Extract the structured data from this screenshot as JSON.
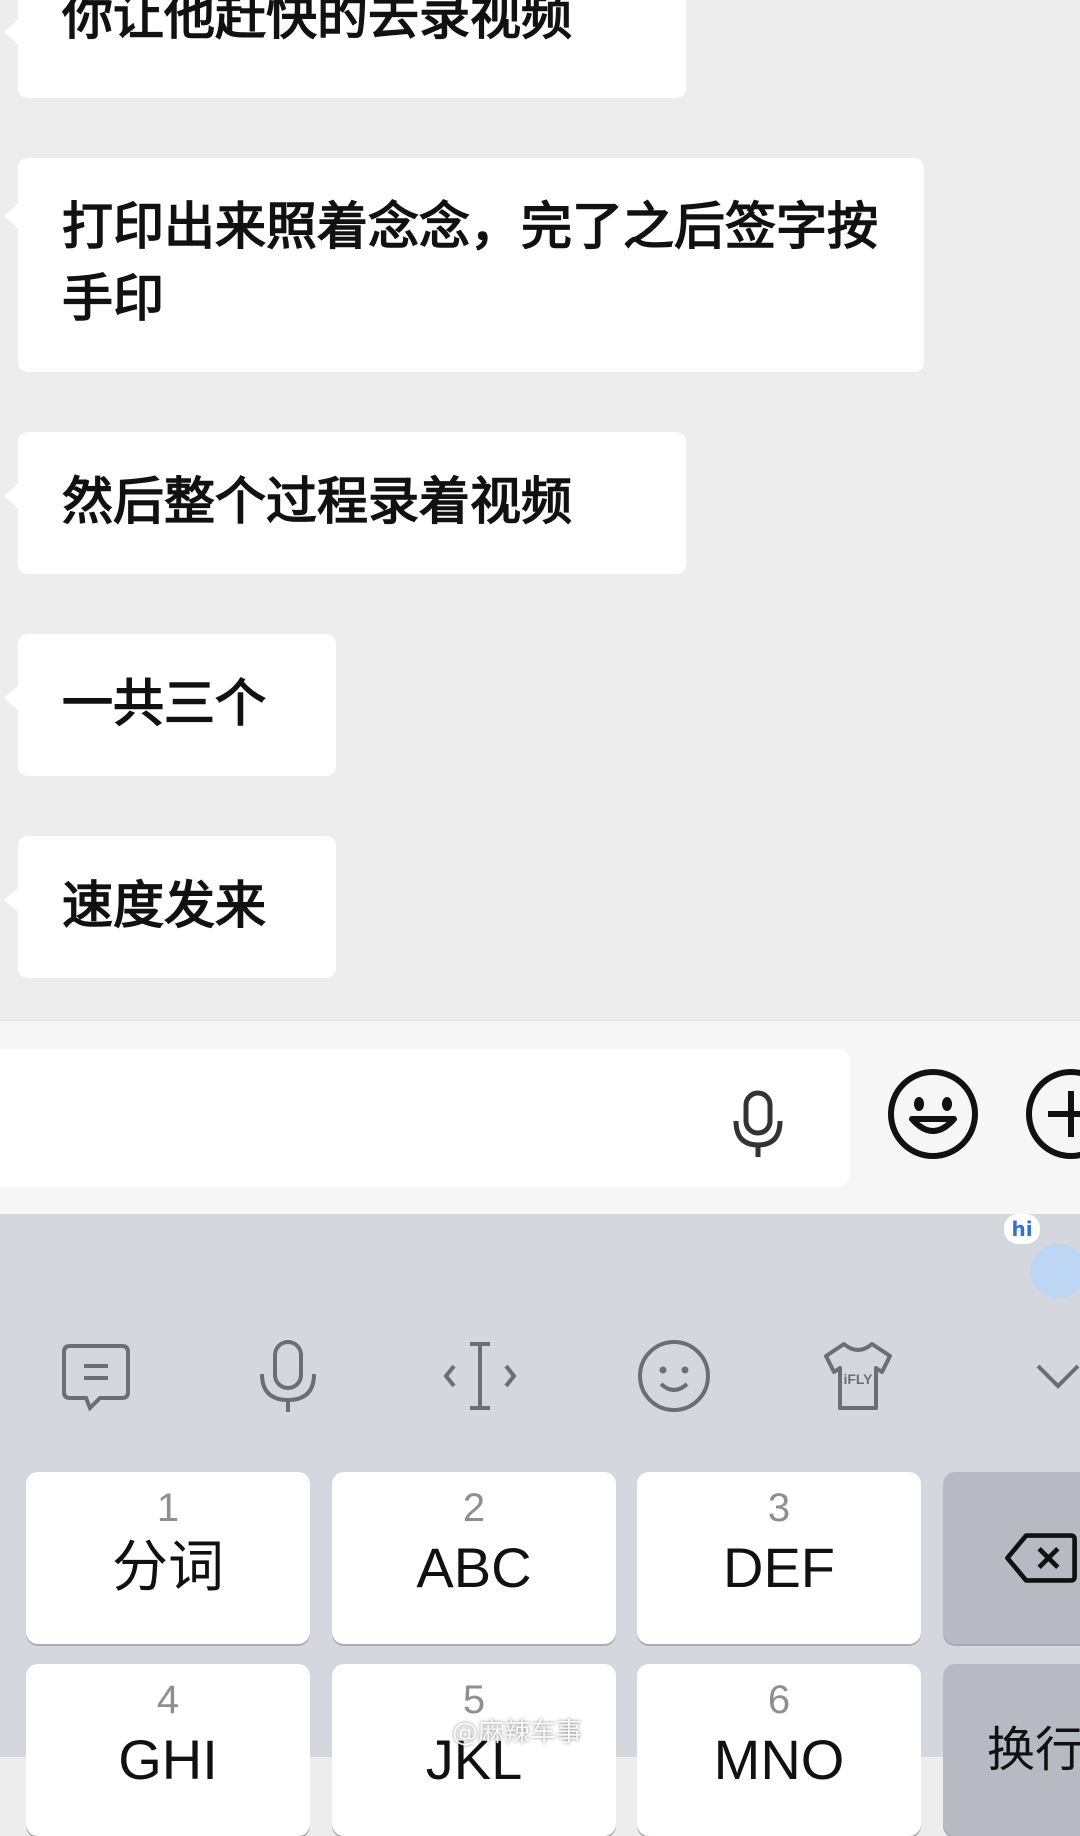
{
  "messages": [
    {
      "text": "你让他赶快的去录视频"
    },
    {
      "text": "打印出来照着念念，完了之后签字按手印"
    },
    {
      "text": "然后整个过程录着视频"
    },
    {
      "text": "一共三个"
    },
    {
      "text": "速度发来"
    }
  ],
  "input_bar": {
    "value": "",
    "icons": [
      "microphone-icon",
      "emoji-icon",
      "plus-icon"
    ]
  },
  "keyboard": {
    "mascot_badge": "hi",
    "toolbar_icons": [
      "clipboard-icon",
      "voice-input-icon",
      "cursor-move-icon",
      "emoji-smile-icon",
      "skin-shirt-icon",
      "collapse-chevron-icon"
    ],
    "skin_badge": "iFLY",
    "keys": [
      {
        "num": "1",
        "label": "分词"
      },
      {
        "num": "2",
        "label": "ABC"
      },
      {
        "num": "3",
        "label": "DEF"
      },
      {
        "num": "4",
        "label": "GHI"
      },
      {
        "num": "5",
        "label": "JKL"
      },
      {
        "num": "6",
        "label": "MNO"
      }
    ],
    "enter_label": "换行"
  },
  "watermark": "@麻辣车事"
}
